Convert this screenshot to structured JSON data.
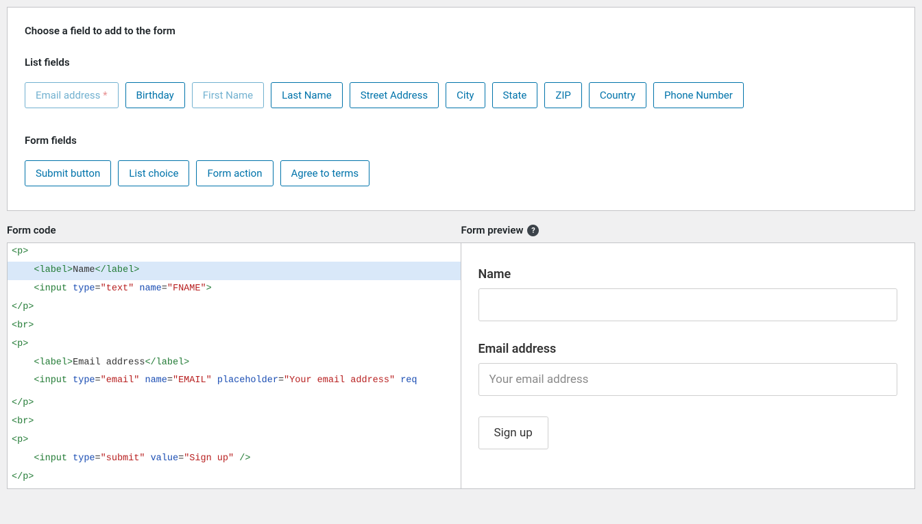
{
  "panel": {
    "heading": "Choose a field to add to the form",
    "list_fields_title": "List fields",
    "list_fields": [
      {
        "label": "Email address",
        "required": true,
        "disabled": true
      },
      {
        "label": "Birthday",
        "required": false,
        "disabled": false
      },
      {
        "label": "First Name",
        "required": false,
        "disabled": true
      },
      {
        "label": "Last Name",
        "required": false,
        "disabled": false
      },
      {
        "label": "Street Address",
        "required": false,
        "disabled": false
      },
      {
        "label": "City",
        "required": false,
        "disabled": false
      },
      {
        "label": "State",
        "required": false,
        "disabled": false
      },
      {
        "label": "ZIP",
        "required": false,
        "disabled": false
      },
      {
        "label": "Country",
        "required": false,
        "disabled": false
      },
      {
        "label": "Phone Number",
        "required": false,
        "disabled": false
      }
    ],
    "form_fields_title": "Form fields",
    "form_fields": [
      {
        "label": "Submit button"
      },
      {
        "label": "List choice"
      },
      {
        "label": "Form action"
      },
      {
        "label": "Agree to terms"
      }
    ]
  },
  "code": {
    "heading": "Form code",
    "lines": [
      {
        "indent": 0,
        "hl": false,
        "segments": [
          {
            "t": "tag",
            "v": "<p>"
          }
        ]
      },
      {
        "indent": 1,
        "hl": true,
        "segments": [
          {
            "t": "tag",
            "v": "<label>"
          },
          {
            "t": "text",
            "v": "Name"
          },
          {
            "t": "tag",
            "v": "</label>"
          }
        ]
      },
      {
        "indent": 1,
        "hl": false,
        "segments": [
          {
            "t": "tag",
            "v": "<input"
          },
          {
            "t": "text",
            "v": " "
          },
          {
            "t": "attr",
            "v": "type"
          },
          {
            "t": "text",
            "v": "="
          },
          {
            "t": "val",
            "v": "\"text\""
          },
          {
            "t": "text",
            "v": " "
          },
          {
            "t": "attr",
            "v": "name"
          },
          {
            "t": "text",
            "v": "="
          },
          {
            "t": "val",
            "v": "\"FNAME\""
          },
          {
            "t": "tag",
            "v": ">"
          }
        ]
      },
      {
        "indent": 0,
        "hl": false,
        "segments": [
          {
            "t": "tag",
            "v": "</p>"
          }
        ]
      },
      {
        "indent": 0,
        "hl": false,
        "segments": [
          {
            "t": "tag",
            "v": "<br>"
          }
        ]
      },
      {
        "indent": 0,
        "hl": false,
        "segments": [
          {
            "t": "tag",
            "v": "<p>"
          }
        ]
      },
      {
        "indent": 1,
        "hl": false,
        "segments": [
          {
            "t": "tag",
            "v": "<label>"
          },
          {
            "t": "text",
            "v": "Email address"
          },
          {
            "t": "tag",
            "v": "</label>"
          }
        ]
      },
      {
        "indent": 1,
        "hl": false,
        "segments": [
          {
            "t": "tag",
            "v": "<input"
          },
          {
            "t": "text",
            "v": " "
          },
          {
            "t": "attr",
            "v": "type"
          },
          {
            "t": "text",
            "v": "="
          },
          {
            "t": "val",
            "v": "\"email\""
          },
          {
            "t": "text",
            "v": " "
          },
          {
            "t": "attr",
            "v": "name"
          },
          {
            "t": "text",
            "v": "="
          },
          {
            "t": "val",
            "v": "\"EMAIL\""
          },
          {
            "t": "text",
            "v": " "
          },
          {
            "t": "attr",
            "v": "placeholder"
          },
          {
            "t": "text",
            "v": "="
          },
          {
            "t": "val",
            "v": "\"Your email address\""
          },
          {
            "t": "text",
            "v": " "
          },
          {
            "t": "attr",
            "v": "req"
          }
        ]
      },
      {
        "indent": 0,
        "hl": false,
        "segments": []
      },
      {
        "indent": 0,
        "hl": false,
        "segments": [
          {
            "t": "tag",
            "v": "</p>"
          }
        ]
      },
      {
        "indent": 0,
        "hl": false,
        "segments": [
          {
            "t": "tag",
            "v": "<br>"
          }
        ]
      },
      {
        "indent": 0,
        "hl": false,
        "segments": [
          {
            "t": "tag",
            "v": "<p>"
          }
        ]
      },
      {
        "indent": 1,
        "hl": false,
        "segments": [
          {
            "t": "tag",
            "v": "<input"
          },
          {
            "t": "text",
            "v": " "
          },
          {
            "t": "attr",
            "v": "type"
          },
          {
            "t": "text",
            "v": "="
          },
          {
            "t": "val",
            "v": "\"submit\""
          },
          {
            "t": "text",
            "v": " "
          },
          {
            "t": "attr",
            "v": "value"
          },
          {
            "t": "text",
            "v": "="
          },
          {
            "t": "val",
            "v": "\"Sign up\""
          },
          {
            "t": "text",
            "v": " "
          },
          {
            "t": "tag",
            "v": "/>"
          }
        ]
      },
      {
        "indent": 0,
        "hl": false,
        "segments": [
          {
            "t": "tag",
            "v": "</p>"
          }
        ]
      }
    ]
  },
  "preview": {
    "heading": "Form preview",
    "name_label": "Name",
    "email_label": "Email address",
    "email_placeholder": "Your email address",
    "submit_label": "Sign up"
  },
  "asterisk": "*"
}
